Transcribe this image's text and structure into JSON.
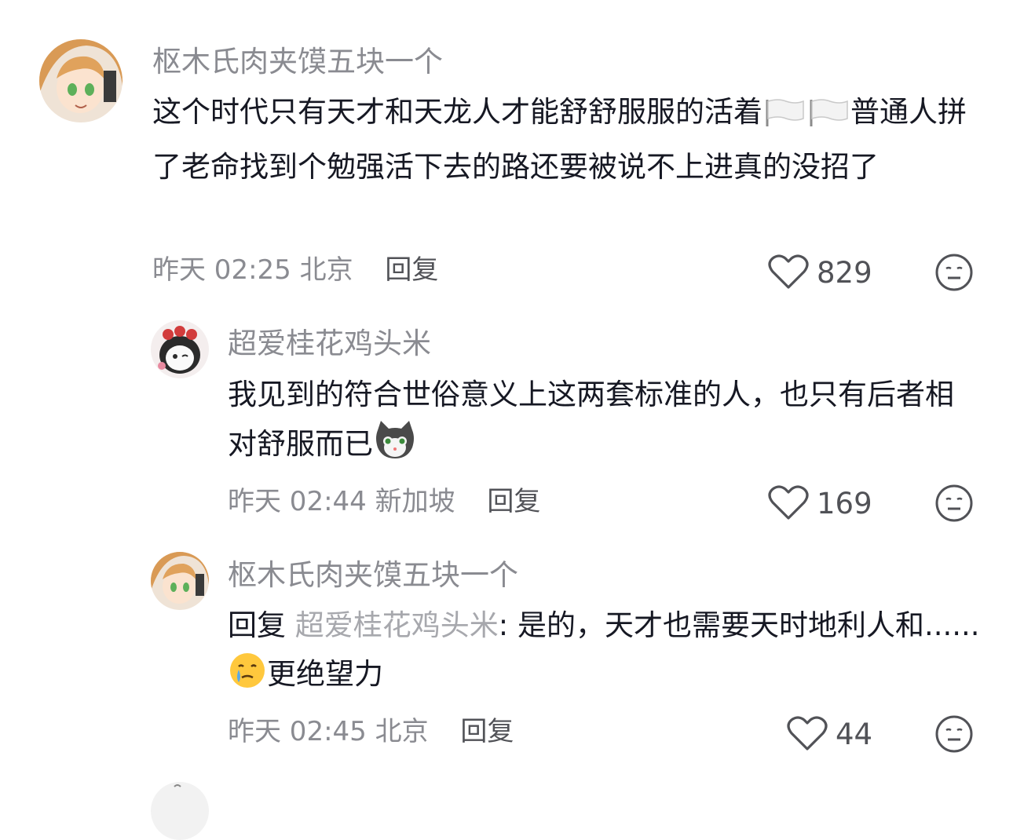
{
  "comments": [
    {
      "username": "枢木氏肉夹馍五块一个",
      "content_1": "这个时代只有天才和天龙人才能舒舒服服的活着",
      "content_2": "普通人拼了老命找到个勉强活下去的路还要被说不上进真的没招了",
      "time": "昨天 02:25",
      "location": "北京",
      "reply_label": "回复",
      "likes": "829"
    },
    {
      "username": "超爱桂花鸡头米",
      "content": "我见到的符合世俗意义上这两套标准的人，也只有后者相对舒服而已",
      "time": "昨天 02:44",
      "location": "新加坡",
      "reply_label": "回复",
      "likes": "169"
    },
    {
      "username": "枢木氏肉夹馍五块一个",
      "reply_prefix": "回复",
      "reply_to": "超爱桂花鸡头米",
      "content_1": ": 是的，天才也需要天时地利人和......",
      "content_2": "更绝望力",
      "time": "昨天 02:45",
      "location": "北京",
      "reply_label": "回复",
      "likes": "44"
    }
  ],
  "icons": {
    "flag": "white-flag-icon",
    "cat": "cat-face-emoji",
    "tear": "face-holding-back-tears-emoji",
    "like": "heart-outline-icon",
    "dislike": "neutral-face-icon"
  },
  "colors": {
    "text": "#161823",
    "secondary": "#8a8b91",
    "reply": "#515257",
    "reply_target": "#a7a8ad"
  }
}
